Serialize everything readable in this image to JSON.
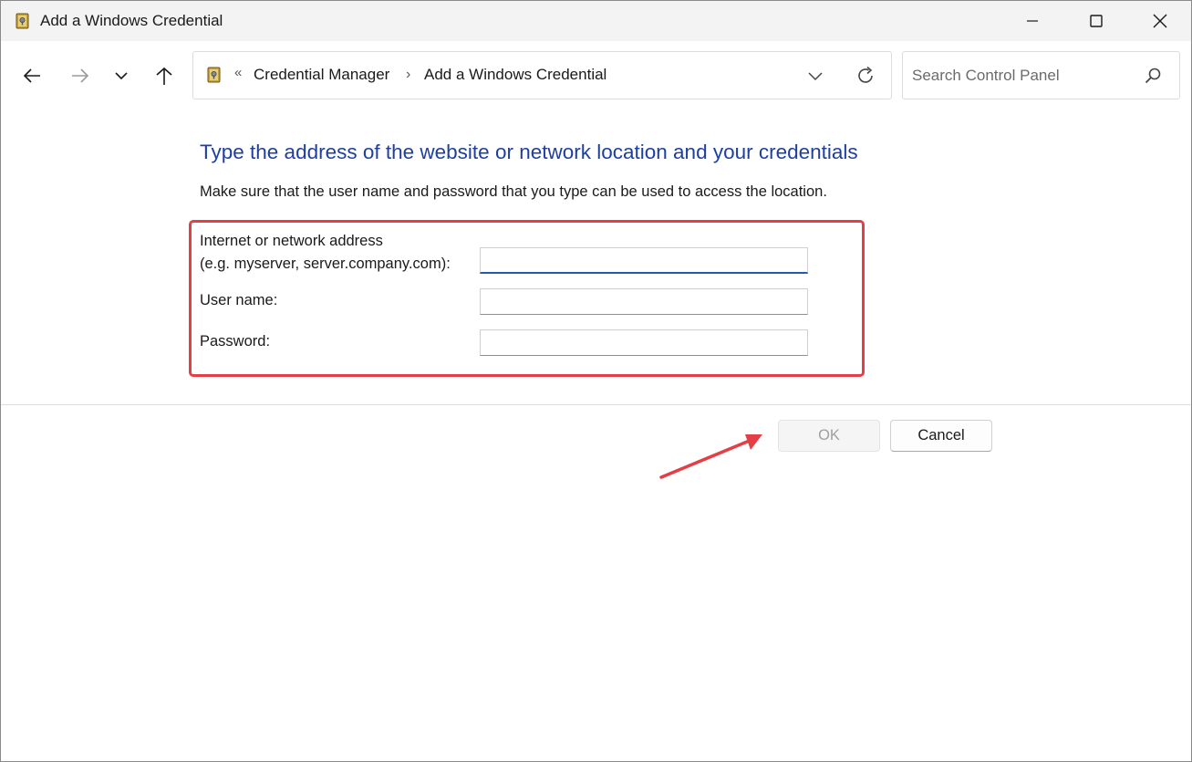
{
  "window": {
    "title": "Add a Windows Credential"
  },
  "nav": {
    "breadcrumb_overflow": "«",
    "breadcrumbs": [
      "Credential Manager",
      "Add a Windows Credential"
    ],
    "separator": "›"
  },
  "search": {
    "placeholder": "Search Control Panel",
    "value": ""
  },
  "content": {
    "heading": "Type the address of the website or network location and your credentials",
    "subtext": "Make sure that the user name and password that you type can be used to access the location.",
    "fields": {
      "address_label_line1": "Internet or network address",
      "address_label_line2": "(e.g. myserver, server.company.com):",
      "address_value": "",
      "username_label": "User name:",
      "username_value": "",
      "password_label": "Password:",
      "password_value": ""
    }
  },
  "buttons": {
    "ok": "OK",
    "ok_enabled": false,
    "cancel": "Cancel"
  },
  "colors": {
    "heading": "#1e3fa0",
    "annotation": "#e33f45",
    "focus_underline": "#1e5fa8"
  },
  "icons": {
    "title": "credential-manager-icon",
    "back": "arrow-left-icon",
    "forward": "arrow-right-icon",
    "recent": "chevron-down-icon",
    "up": "arrow-up-icon",
    "refresh": "refresh-icon",
    "search": "search-icon"
  }
}
